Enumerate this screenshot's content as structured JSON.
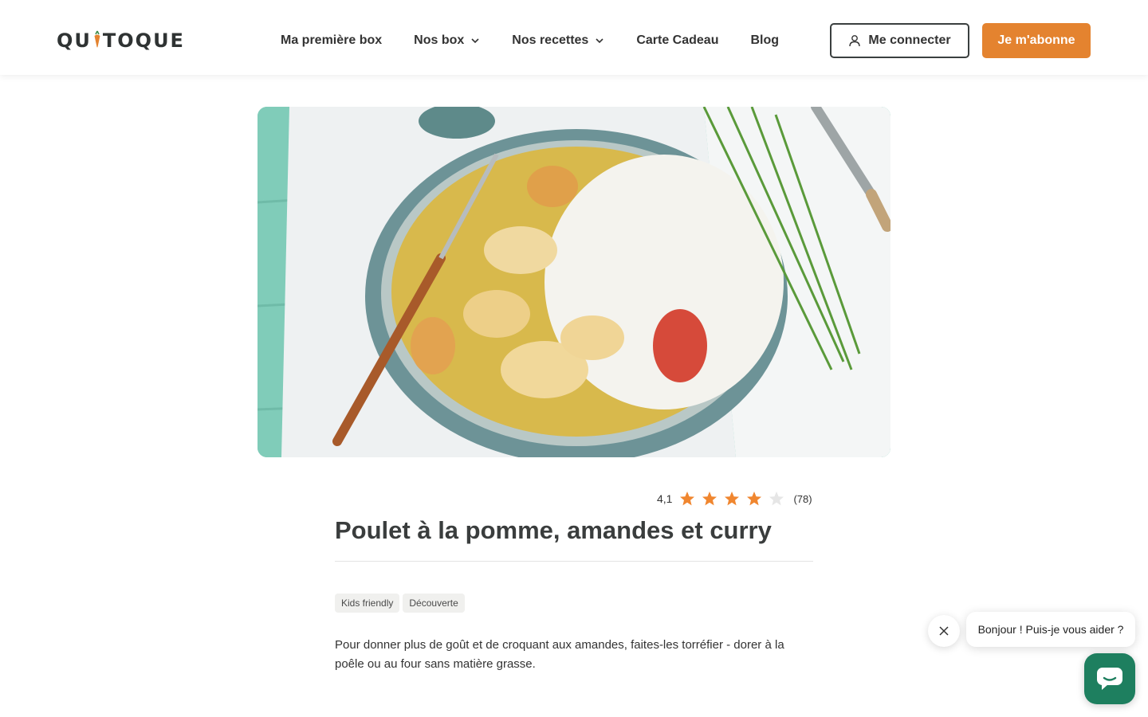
{
  "brand": {
    "logo_text_left": "QU",
    "logo_text_right": "TOQUE",
    "accent": "#e4832f",
    "chat_green": "#1e7f5f"
  },
  "nav": {
    "items": [
      {
        "label": "Ma première box"
      },
      {
        "label": "Nos box"
      },
      {
        "label": "Nos recettes"
      },
      {
        "label": "Carte Cadeau"
      },
      {
        "label": "Blog"
      }
    ]
  },
  "header": {
    "login_label": "Me connecter",
    "subscribe_label": "Je m'abonne"
  },
  "recipe": {
    "rating_value": "4,1",
    "rating_stars": 4.1,
    "rating_count": "(78)",
    "title": "Poulet à la pomme, amandes et curry",
    "tags": [
      "Kids friendly",
      "Découverte"
    ],
    "description": "Pour donner plus de goût et de croquant aux amandes, faites-les torréfier - dorer à la poêle ou au four sans matière grasse."
  },
  "chat": {
    "message": "Bonjour ! Puis-je vous aider ?"
  }
}
